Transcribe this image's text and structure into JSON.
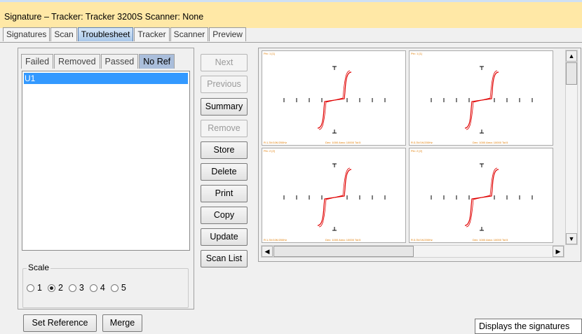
{
  "window": {
    "title": "Signature – Tracker: Tracker 3200S  Scanner: None"
  },
  "tabs": [
    "Signatures",
    "Scan",
    "Troublesheet",
    "Tracker",
    "Scanner",
    "Preview"
  ],
  "active_tab": "Troublesheet",
  "subtabs": [
    "Failed",
    "Removed",
    "Passed",
    "No Ref"
  ],
  "active_subtab": "No Ref",
  "list": {
    "items": [
      "U1"
    ],
    "selected": "U1"
  },
  "buttons": {
    "next": {
      "label": "Next",
      "enabled": false
    },
    "previous": {
      "label": "Previous",
      "enabled": false
    },
    "summary": {
      "label": "Summary",
      "enabled": true
    },
    "remove": {
      "label": "Remove",
      "enabled": false
    },
    "store": {
      "label": "Store",
      "enabled": true
    },
    "delete": {
      "label": "Delete",
      "enabled": true
    },
    "print": {
      "label": "Print",
      "enabled": true
    },
    "copy": {
      "label": "Copy",
      "enabled": true
    },
    "update": {
      "label": "Update",
      "enabled": true
    },
    "scan_list": {
      "label": "Scan List",
      "enabled": true
    },
    "set_reference": {
      "label": "Set Reference"
    },
    "merge": {
      "label": "Merge"
    }
  },
  "scale": {
    "legend": "Scale",
    "options": [
      "1",
      "2",
      "3",
      "4",
      "5"
    ],
    "selected": "2"
  },
  "plots": [
    {
      "pin": "Pin: 1 [1]",
      "settings": "R:1.3V/10K/200Hz",
      "stats": "Dev: 1000 Area: 10000 Tol:5"
    },
    {
      "pin": "Pin: 1 [1]",
      "settings": "R:3.3V/1K/200Hz",
      "stats": "Dev: 1000 Area: 10000 Tol:5"
    },
    {
      "pin": "Pin: 2 [2]",
      "settings": "R:1.3V/10K/200Hz",
      "stats": "Dev: 1000 Area: 10000 Tol:5"
    },
    {
      "pin": "Pin: 2 [2]",
      "settings": "R:3.3V/1K/200Hz",
      "stats": "Dev: 1000 Area: 10000 Tol:5"
    }
  ],
  "tooltip": "Displays the signatures",
  "colors": {
    "accent": "#3399ff",
    "title_bar": "#ffe8a6",
    "curve": "#e00000",
    "plot_label": "#e07b00"
  }
}
